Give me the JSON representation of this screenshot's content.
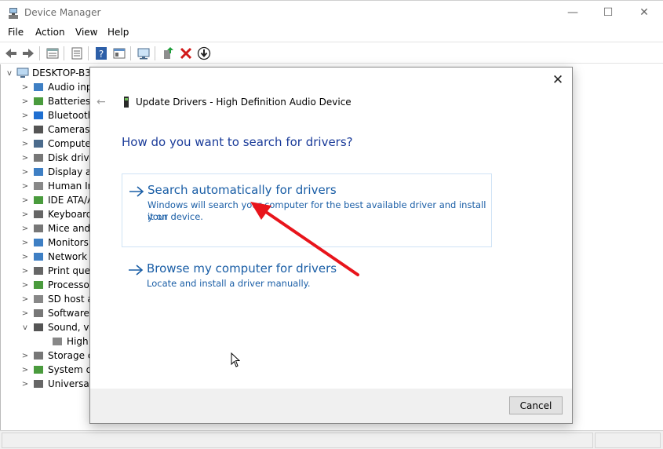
{
  "window": {
    "title": "Device Manager",
    "controls": {
      "minimize": "—",
      "maximize": "☐",
      "close": "✕"
    }
  },
  "menu": [
    "File",
    "Action",
    "View",
    "Help"
  ],
  "toolbar_icons": [
    "back-arrow-icon",
    "forward-arrow-icon",
    "properties-icon",
    "details-icon",
    "help-icon",
    "view-icon",
    "computer-monitor-icon",
    "update-driver-icon",
    "uninstall-icon",
    "download-icon"
  ],
  "tree": {
    "root": "DESKTOP-B3C",
    "items": [
      {
        "label": "Audio inp",
        "expander": ">"
      },
      {
        "label": "Batteries",
        "expander": ">"
      },
      {
        "label": "Bluetooth",
        "expander": ">"
      },
      {
        "label": "Cameras",
        "expander": ">"
      },
      {
        "label": "Compute",
        "expander": ">"
      },
      {
        "label": "Disk drive",
        "expander": ">"
      },
      {
        "label": "Display a",
        "expander": ">"
      },
      {
        "label": "Human In",
        "expander": ">"
      },
      {
        "label": "IDE ATA/A",
        "expander": ">"
      },
      {
        "label": "Keyboard",
        "expander": ">"
      },
      {
        "label": "Mice and",
        "expander": ">"
      },
      {
        "label": "Monitors",
        "expander": ">"
      },
      {
        "label": "Network a",
        "expander": ">"
      },
      {
        "label": "Print queu",
        "expander": ">"
      },
      {
        "label": "Processor",
        "expander": ">"
      },
      {
        "label": "SD host a",
        "expander": ">"
      },
      {
        "label": "Software",
        "expander": ">"
      },
      {
        "label": "Sound, vi",
        "expander": "v"
      },
      {
        "label": "High D",
        "expander": ""
      },
      {
        "label": "Storage c",
        "expander": ">"
      },
      {
        "label": "System de",
        "expander": ">"
      },
      {
        "label": "Universal",
        "expander": ">"
      }
    ]
  },
  "dialog": {
    "title": "Update Drivers - High Definition Audio Device",
    "heading": "How do you want to search for drivers?",
    "options": [
      {
        "title": "Search automatically for drivers",
        "desc_line1": "Windows will search your computer for the best available driver and install it on",
        "desc_line2": "your device."
      },
      {
        "title": "Browse my computer for drivers",
        "desc_line1": "Locate and install a driver manually."
      }
    ],
    "cancel_label": "Cancel",
    "close_glyph": "✕",
    "back_glyph": "←"
  },
  "colors": {
    "link_blue": "#1a5ea6",
    "heading_blue": "#1a3b99",
    "annotation_red": "#e8141b"
  }
}
